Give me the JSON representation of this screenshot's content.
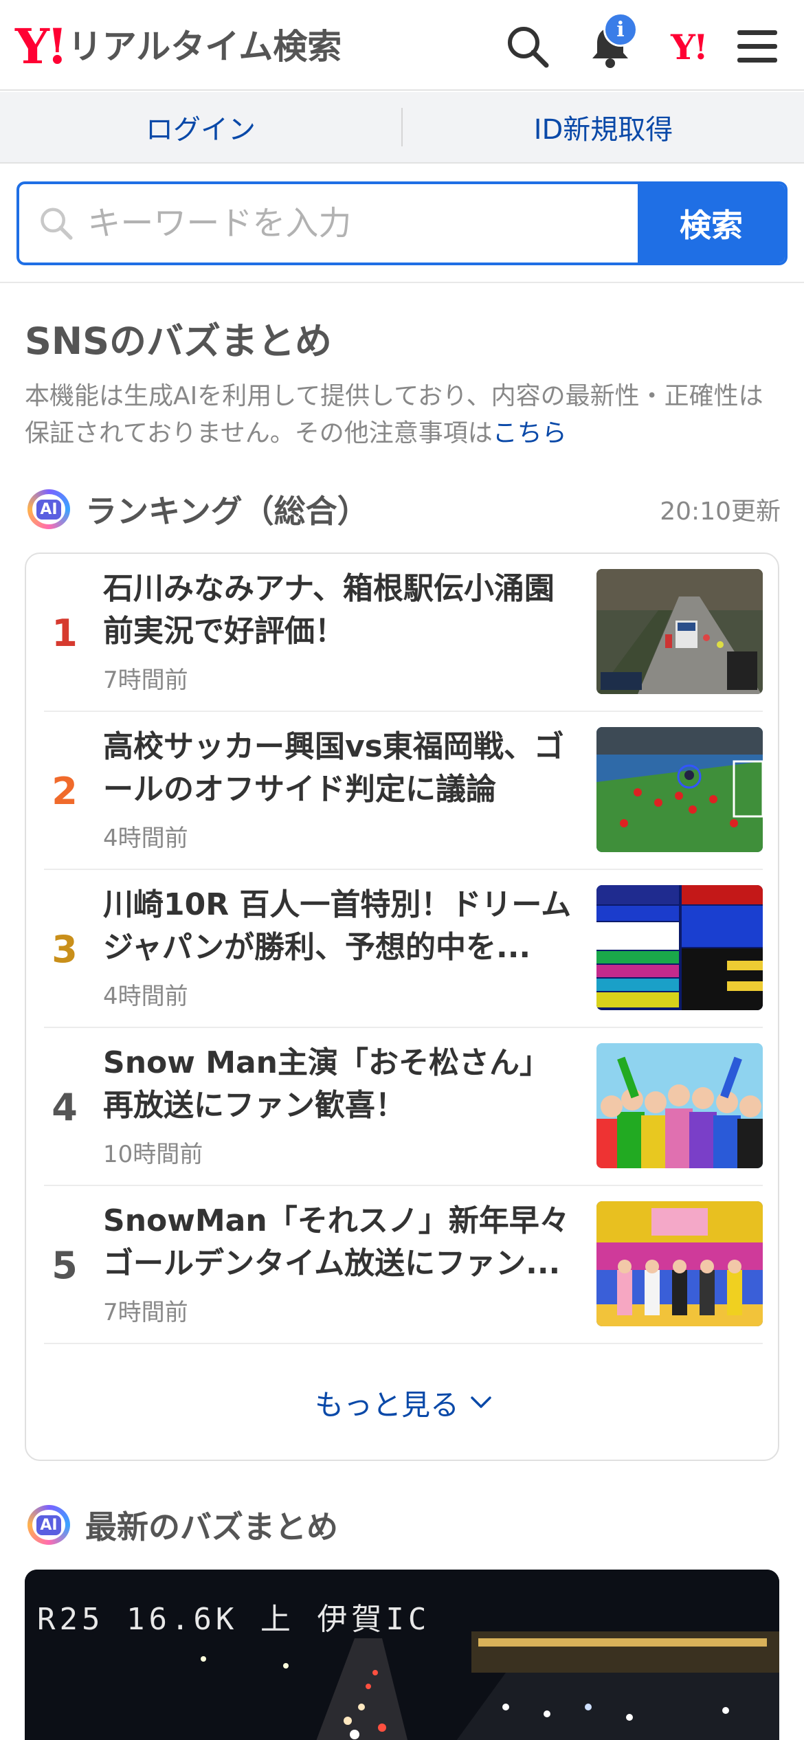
{
  "header": {
    "logo_mark": "Y!",
    "logo_title": "リアルタイム検索",
    "notification_badge": "i",
    "yj_mark": "Y!"
  },
  "account": {
    "login": "ログイン",
    "register": "ID新規取得"
  },
  "search": {
    "placeholder": "キーワードを入力",
    "button": "検索"
  },
  "section": {
    "title": "SNSのバズまとめ",
    "notice": "本機能は生成AIを利用して提供しており、内容の最新性・正確性は保証されておりません。その他注意事項は",
    "notice_link": "こちら"
  },
  "ranking": {
    "ai_badge": "AI",
    "label": "ランキング（総合）",
    "updated": "20:10更新",
    "items": [
      {
        "rank": "1",
        "color": "#d63a2f",
        "headline": "石川みなみアナ、箱根駅伝小涌園前実況で好評価！",
        "ago": "7時間前",
        "thumb": "road-race-icon"
      },
      {
        "rank": "2",
        "color": "#f06a2b",
        "headline": "高校サッカー興国vs東福岡戦、ゴールのオフサイド判定に議論",
        "ago": "4時間前",
        "thumb": "soccer-icon"
      },
      {
        "rank": "3",
        "color": "#c98f1a",
        "headline": "川崎10R 百人一首特別！ドリームジャパンが勝利、予想的中を...",
        "ago": "4時間前",
        "thumb": "odds-board-icon"
      },
      {
        "rank": "4",
        "color": "#555555",
        "headline": "Snow Man主演「おそ松さん」再放送にファン歓喜！",
        "ago": "10時間前",
        "thumb": "group-photo-icon"
      },
      {
        "rank": "5",
        "color": "#555555",
        "headline": "SnowMan「それスノ」新年早々ゴールデンタイム放送にファン...",
        "ago": "7時間前",
        "thumb": "tv-studio-icon"
      }
    ],
    "more": "もっと見る"
  },
  "latest": {
    "ai_badge": "AI",
    "label": "最新のバズまとめ",
    "camera_caption": "R25 16.6K 上 伊賀IC"
  },
  "colors": {
    "accent_blue": "#1f6fe5",
    "link_blue": "#0a49a8",
    "yahoo_red": "#ff0033"
  }
}
